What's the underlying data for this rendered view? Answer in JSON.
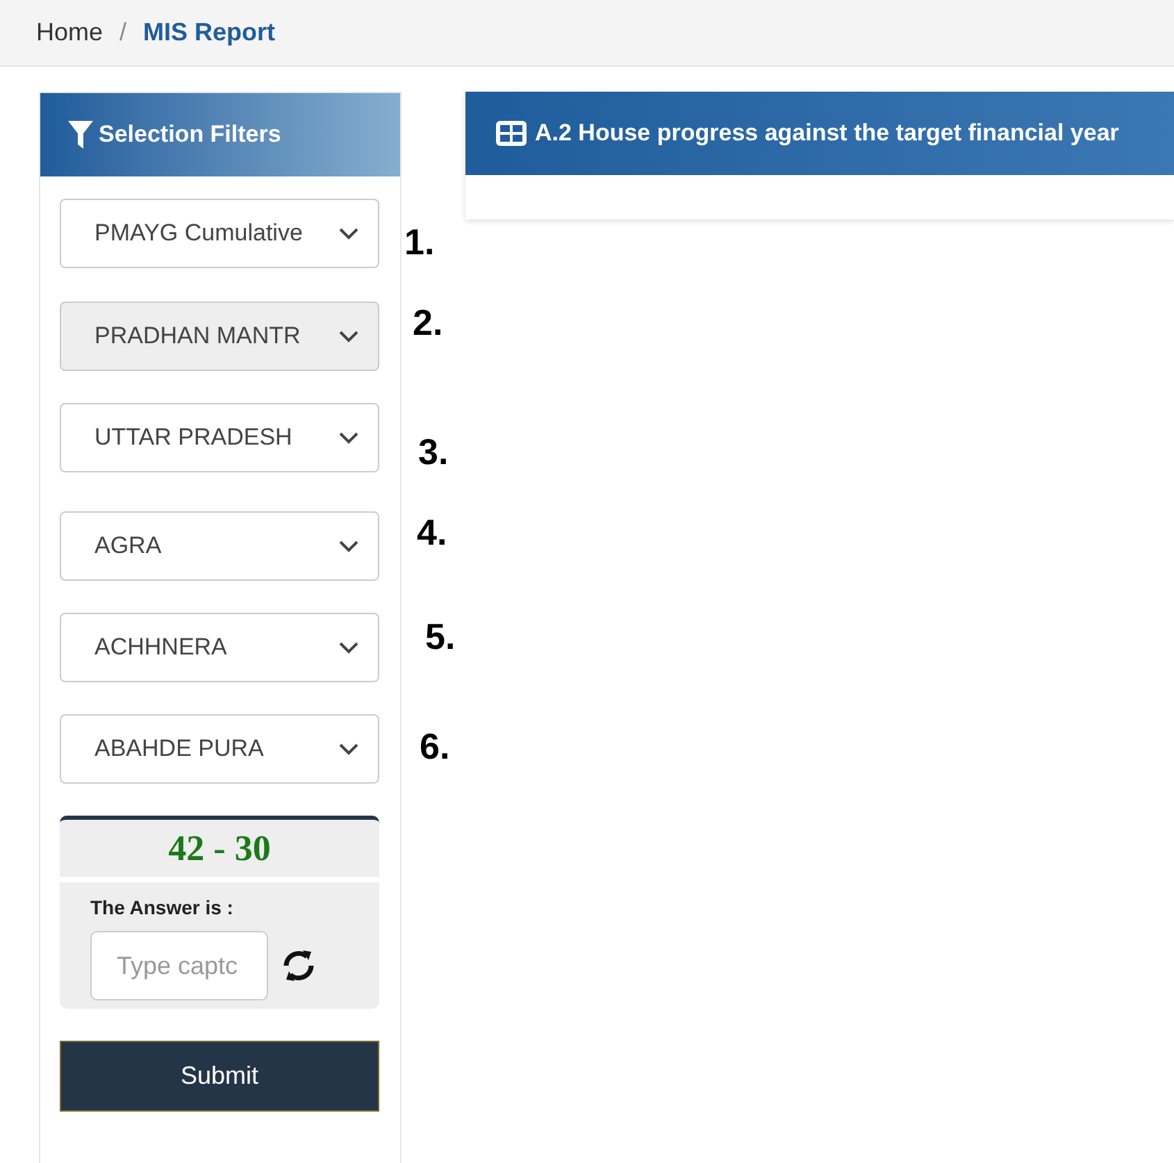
{
  "breadcrumb": [
    {
      "label": "Home",
      "selected": false
    },
    {
      "label": "MIS Report",
      "selected": true
    }
  ],
  "breadcrumb_separator": "/",
  "filters": {
    "title": "Selection Filters",
    "selects": [
      {
        "value": "PMAYG Cumulative",
        "disabled": false,
        "annotation": "1."
      },
      {
        "value": "PRADHAN MANTR",
        "disabled": true,
        "annotation": "2."
      },
      {
        "value": "UTTAR PRADESH",
        "disabled": false,
        "annotation": "3."
      },
      {
        "value": "AGRA",
        "disabled": false,
        "annotation": "4."
      },
      {
        "value": "ACHHNERA",
        "disabled": false,
        "annotation": "5."
      },
      {
        "value": "ABAHDE PURA",
        "disabled": false,
        "annotation": "6."
      }
    ],
    "captcha": {
      "challenge": "42 - 30",
      "label": "The Answer is :",
      "placeholder": "Type captc"
    },
    "submit": "Submit"
  },
  "report": {
    "title": "A.2 House progress against the target financial year"
  }
}
